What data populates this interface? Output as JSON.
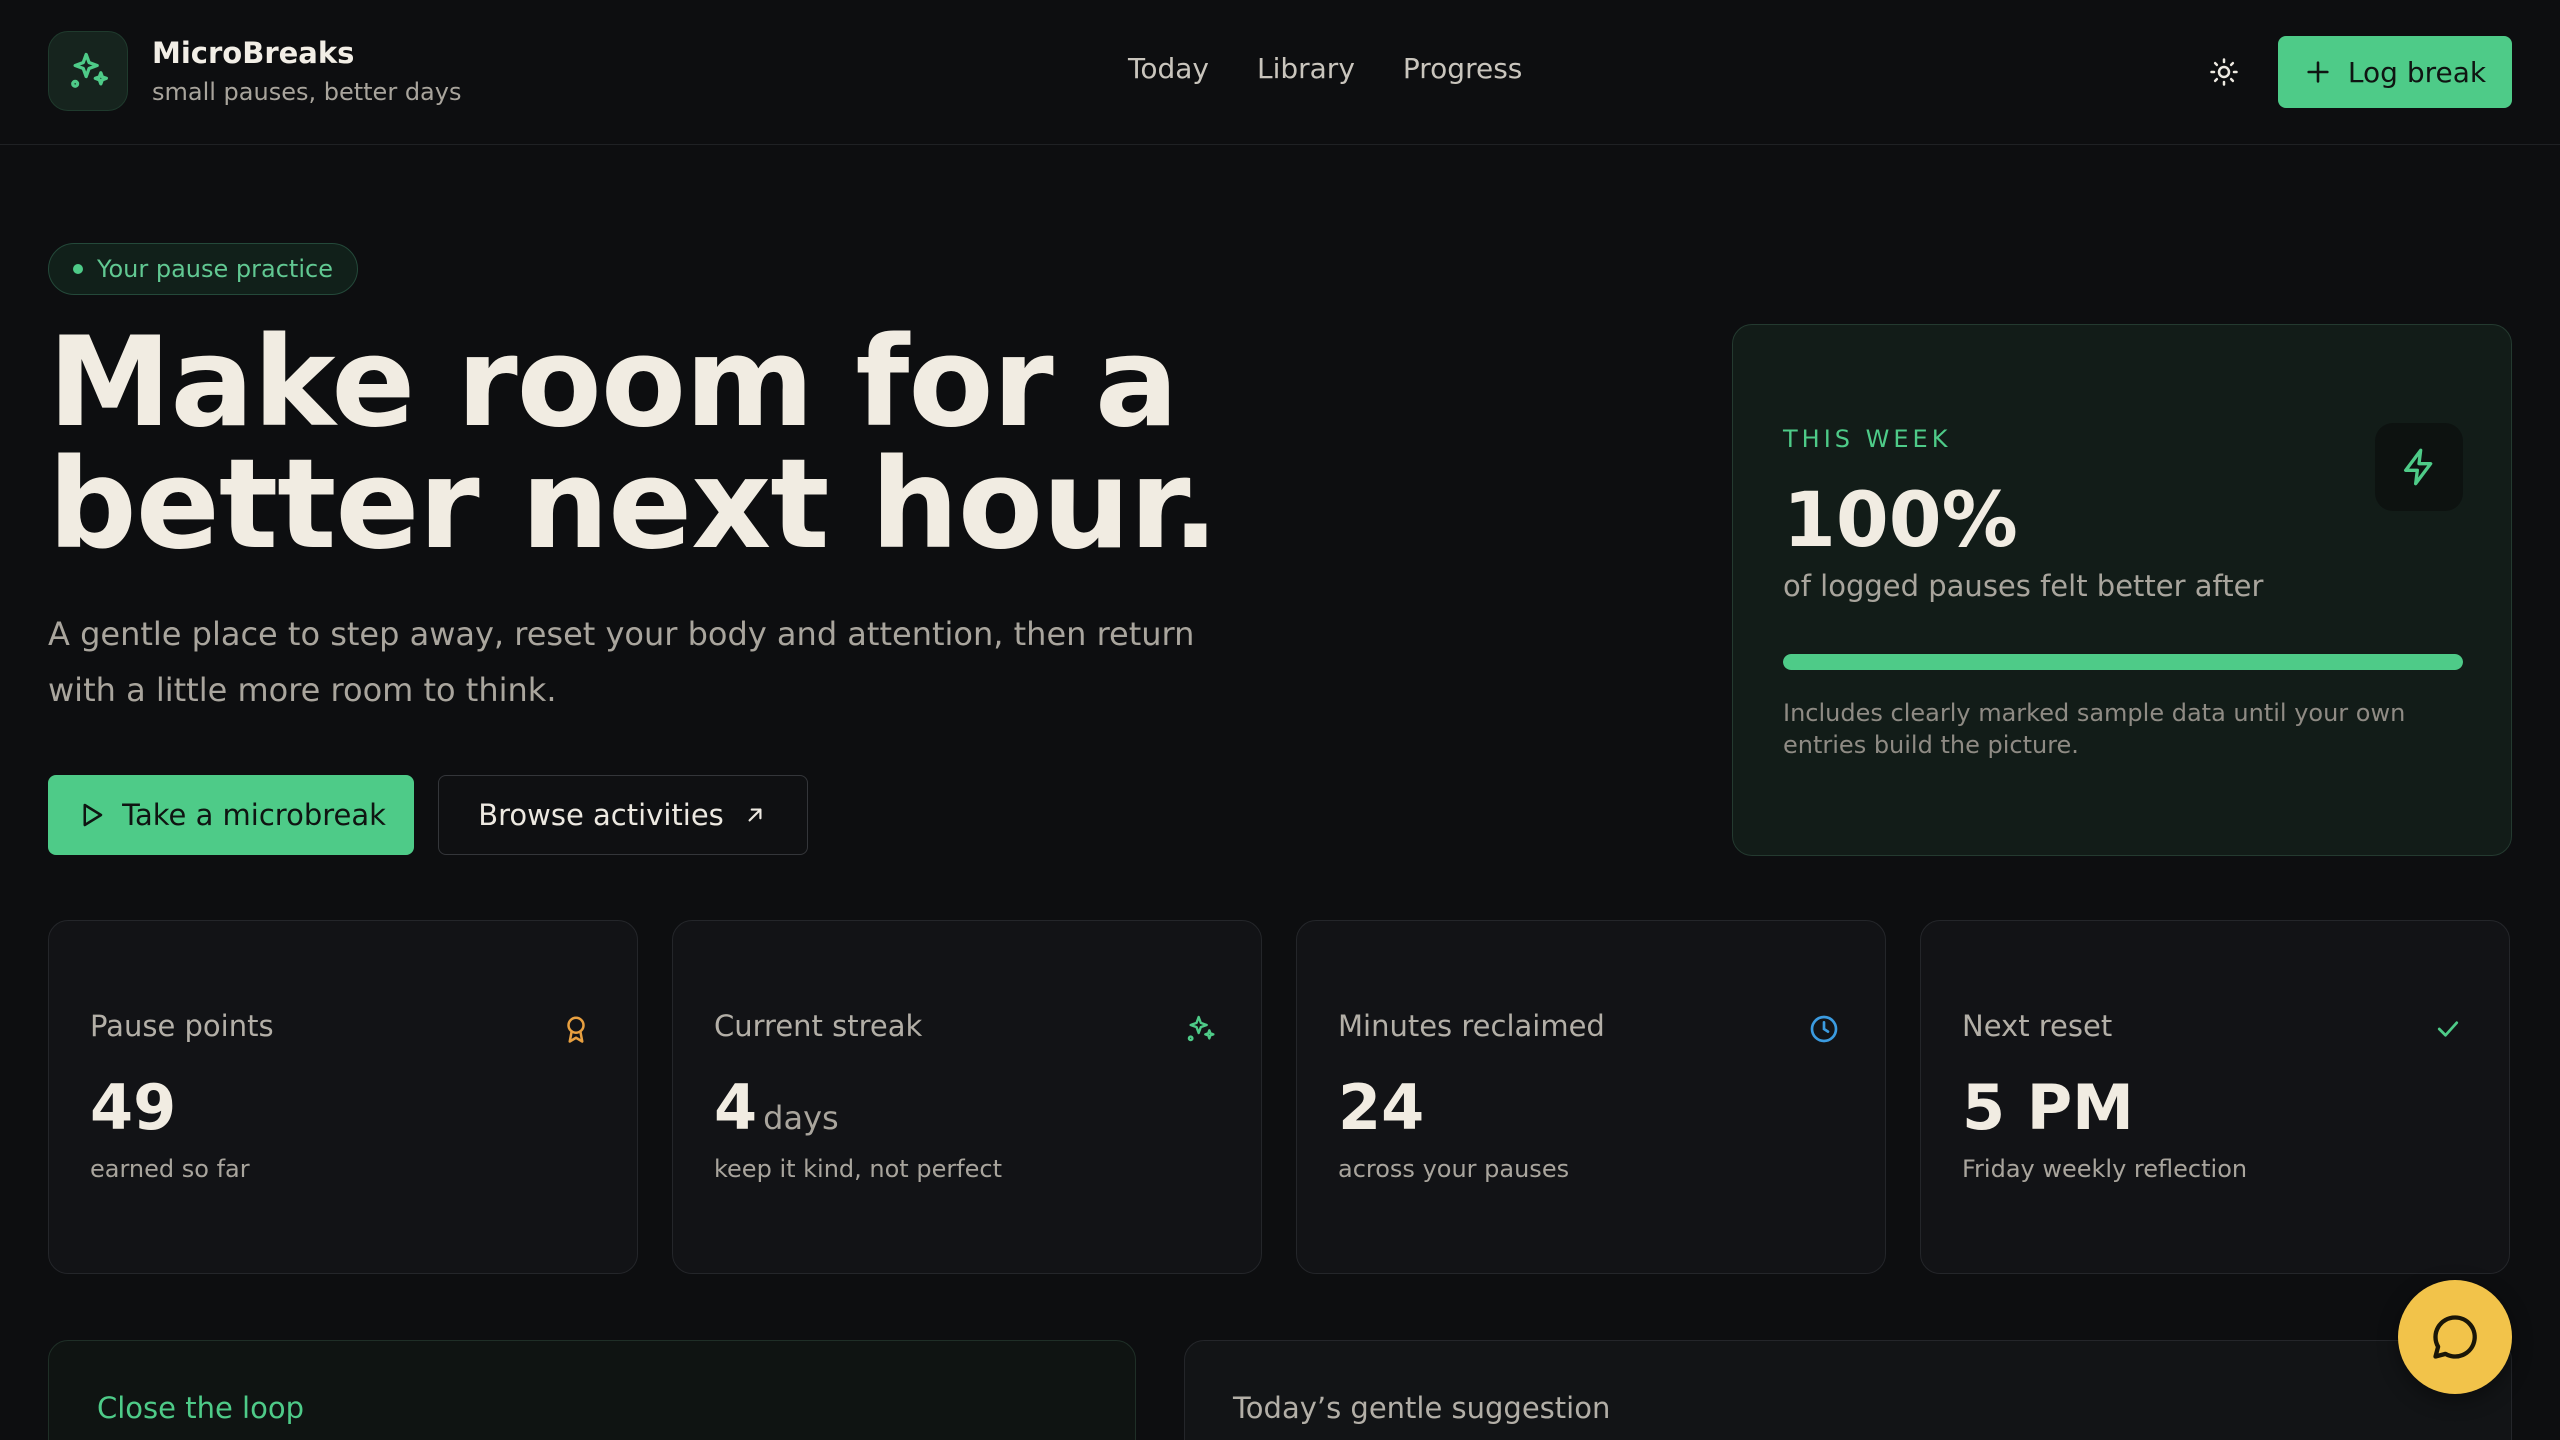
{
  "brand": {
    "name": "MicroBreaks",
    "tagline": "small pauses, better days",
    "logo_icon": "sparkles-icon"
  },
  "nav": {
    "items": [
      {
        "label": "Today"
      },
      {
        "label": "Library"
      },
      {
        "label": "Progress"
      }
    ]
  },
  "header": {
    "theme_icon": "sun-icon",
    "log_button": "Log break"
  },
  "hero": {
    "pill": "Your pause practice",
    "title_line1": "Make room for a",
    "title_line2": "better next hour.",
    "subtitle_line1": "A gentle place to step away, reset your body and attention, then return",
    "subtitle_line2": "with a little more room to think.",
    "primary_cta": "Take a microbreak",
    "secondary_cta": "Browse activities"
  },
  "week": {
    "label": "THIS WEEK",
    "value": "100%",
    "progress": 1.0,
    "description": "of logged pauses felt better after",
    "note": "Includes clearly marked sample data until your own entries build the picture.",
    "icon": "lightning-icon"
  },
  "stats": [
    {
      "label": "Pause points",
      "value": "49",
      "unit": "",
      "sub": "earned so far",
      "icon": "award-icon",
      "color": "#e8a040"
    },
    {
      "label": "Current streak",
      "value": "4",
      "unit": "days",
      "sub": "keep it kind, not perfect",
      "icon": "sparkles-icon",
      "color": "#4ecb88"
    },
    {
      "label": "Minutes reclaimed",
      "value": "24",
      "unit": "",
      "sub": "across your pauses",
      "icon": "clock-icon",
      "color": "#3b9be0"
    },
    {
      "label": "Next reset",
      "value": "5 PM",
      "unit": "",
      "sub": "Friday weekly reflection",
      "icon": "check-icon",
      "color": "#4ecb88"
    }
  ],
  "lower": {
    "left_title": "Close the loop",
    "right_title": "Today’s gentle suggestion"
  },
  "colors": {
    "accent": "#4ecb88",
    "background": "#0d0e10",
    "chat": "#f2c34a"
  }
}
